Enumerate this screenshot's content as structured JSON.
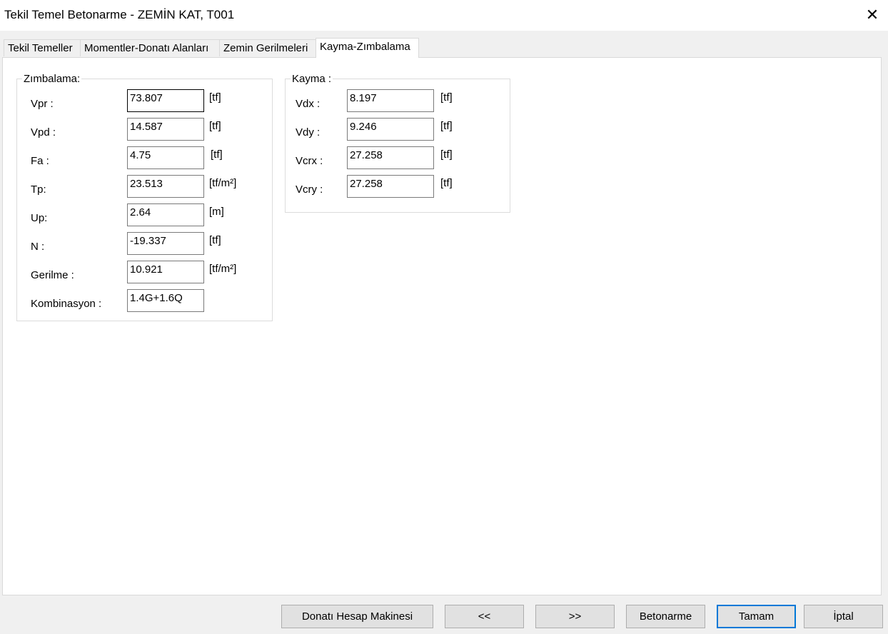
{
  "window": {
    "title": "Tekil Temel Betonarme - ZEMİN KAT, T001",
    "close": "✕"
  },
  "tabs": [
    {
      "label": "Tekil Temeller"
    },
    {
      "label": "Momentler-Donatı Alanları"
    },
    {
      "label": "Zemin Gerilmeleri"
    },
    {
      "label": "Kayma-Zımbalama"
    }
  ],
  "zimbalama": {
    "title": "Zımbalama:",
    "rows": [
      {
        "label": "Vpr :",
        "value": "73.807",
        "unit": "[tf]"
      },
      {
        "label": "Vpd :",
        "value": "14.587",
        "unit": "[tf]"
      },
      {
        "label": "Fa :",
        "value": "4.75",
        "unit": "[tf]"
      },
      {
        "label": "Tp:",
        "value": "23.513",
        "unit": "[tf/m²]"
      },
      {
        "label": "Up:",
        "value": "2.64",
        "unit": "[m]"
      },
      {
        "label": "N :",
        "value": "-19.337",
        "unit": "[tf]"
      },
      {
        "label": "Gerilme :",
        "value": "10.921",
        "unit": "[tf/m²]"
      },
      {
        "label": "Kombinasyon :",
        "value": "1.4G+1.6Q",
        "unit": ""
      }
    ]
  },
  "kayma": {
    "title": "Kayma :",
    "rows": [
      {
        "label": "Vdx :",
        "value": "8.197",
        "unit": "[tf]"
      },
      {
        "label": "Vdy :",
        "value": "9.246",
        "unit": "[tf]"
      },
      {
        "label": "Vcrx :",
        "value": "27.258",
        "unit": "[tf]"
      },
      {
        "label": "Vcry :",
        "value": "27.258",
        "unit": "[tf]"
      }
    ]
  },
  "buttons": {
    "calc": "Donatı Hesap Makinesi",
    "prev": "<<",
    "next": ">>",
    "betonarme": "Betonarme",
    "ok": "Tamam",
    "cancel": "İptal"
  }
}
